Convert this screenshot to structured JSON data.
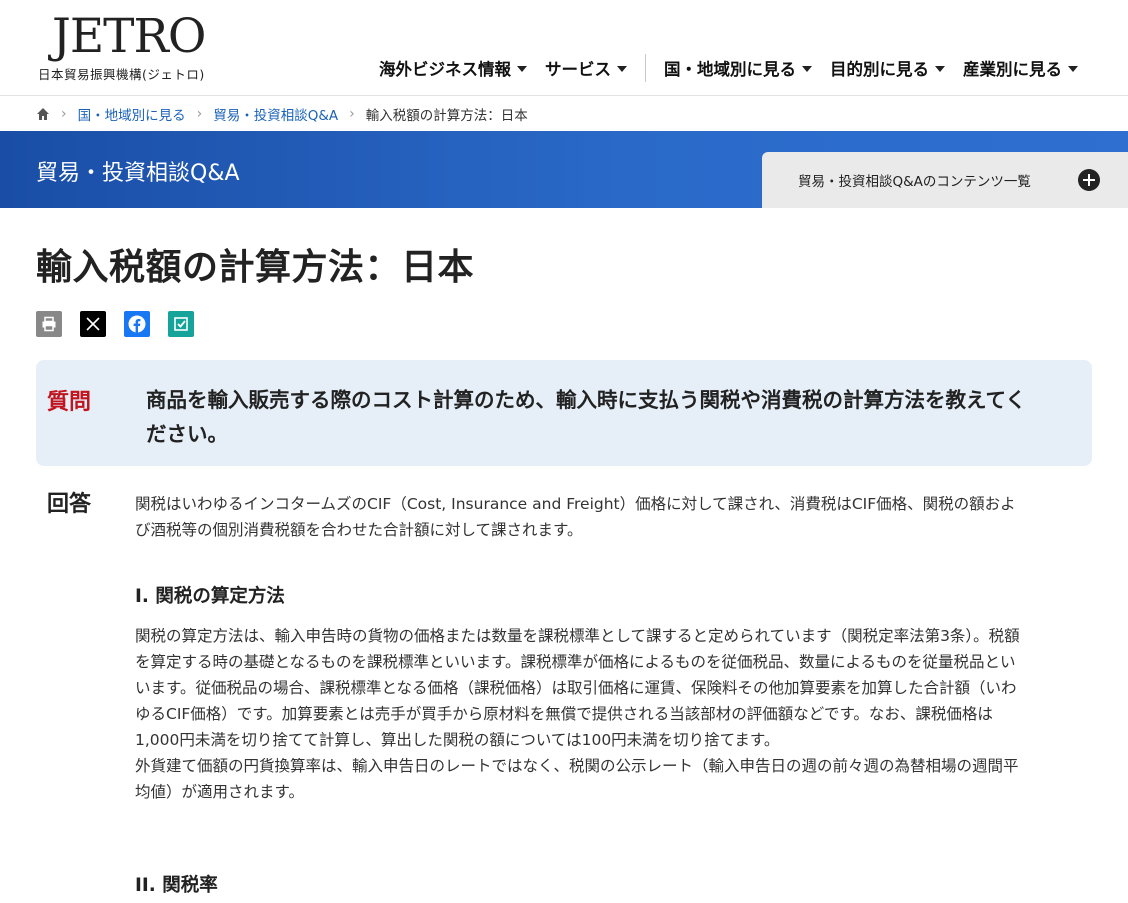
{
  "header": {
    "logo_main": "JETRO",
    "logo_sub": "日本貿易振興機構(ジェトロ)",
    "nav": [
      {
        "label": "海外ビジネス情報"
      },
      {
        "label": "サービス"
      },
      {
        "label": "国・地域別に見る"
      },
      {
        "label": "目的別に見る"
      },
      {
        "label": "産業別に見る"
      }
    ]
  },
  "breadcrumb": {
    "items": [
      "国・地域別に見る",
      "貿易・投資相談Q&A"
    ],
    "current": "輸入税額の計算方法：日本"
  },
  "band": {
    "title": "貿易・投資相談Q&A",
    "tab_label": "貿易・投資相談Q&Aのコンテンツ一覧"
  },
  "page": {
    "title": "輸入税額の計算方法：日本"
  },
  "question": {
    "label": "質問",
    "text": "商品を輸入販売する際のコスト計算のため、輸入時に支払う関税や消費税の計算方法を教えてください。"
  },
  "answer": {
    "label": "回答",
    "text": "関税はいわゆるインコタームズのCIF（Cost, Insurance and Freight）価格に対して課され、消費税はCIF価格、関税の額および酒税等の個別消費税額を合わせた合計額に対して課されます。",
    "section1": {
      "title": "I. 関税の算定方法",
      "para1": "関税の算定方法は、輸入申告時の貨物の価格または数量を課税標準として課すると定められています（関税定率法第3条）。税額を算定する時の基礎となるものを課税標準といいます。課税標準が価格によるものを従価税品、数量によるものを従量税品といいます。従価税品の場合、課税標準となる価格（課税価格）は取引価格に運賃、保険料その他加算要素を加算した合計額（いわゆるCIF価格）です。加算要素とは売手が買手から原材料を無償で提供される当該部材の評価額などです。なお、課税価格は1,000円未満を切り捨てて計算し、算出した関税の額については100円未満を切り捨てます。",
      "para2": "外貨建て価額の円貨換算率は、輸入申告日のレートではなく、税関の公示レート（輸入申告日の週の前々週の為替相場の週間平均値）が適用されます。"
    },
    "section2": {
      "title": "II. 関税率"
    }
  }
}
